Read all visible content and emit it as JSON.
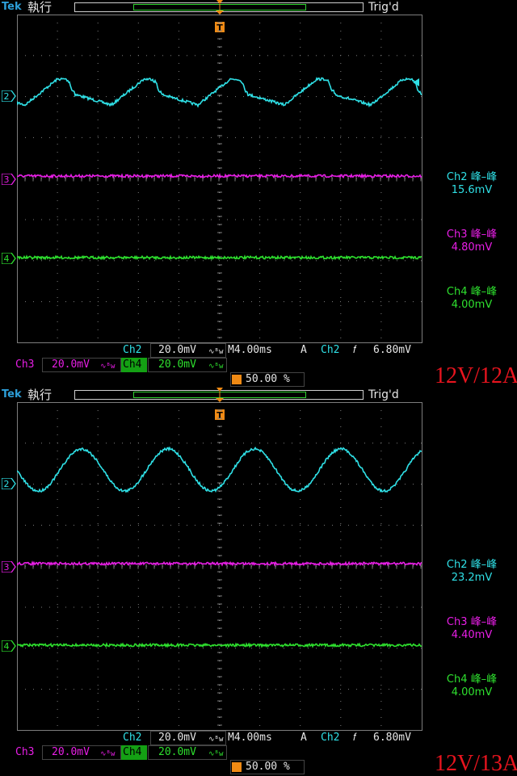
{
  "colors": {
    "ch2": "#2fe0e6",
    "ch3": "#e81ee6",
    "ch4": "#2ee02e",
    "grid": "#7d7d7d",
    "trigger": "#f08a14",
    "text": "#e6e6e6",
    "label": "#e8141e",
    "ch4_box_bg": "#14a014"
  },
  "icons": {
    "trigger_marker": "T",
    "trigger_slope": "rising-edge-icon",
    "bandwidth": "bandwidth-limit-icon",
    "channel_arrow": "channel-ground-arrow-icon"
  },
  "panels": [
    {
      "brand": "Tek",
      "run_state": "執行",
      "trigger_status": "Trig'd",
      "channel_markers": [
        "2",
        "3",
        "4"
      ],
      "waveform_ch2": "sawtooth",
      "measurements": [
        {
          "label": "Ch2 峰–峰",
          "value": "15.6mV",
          "channel": "ch2"
        },
        {
          "label": "Ch3 峰–峰",
          "value": "4.80mV",
          "channel": "ch3"
        },
        {
          "label": "Ch4 峰–峰",
          "value": "4.00mV",
          "channel": "ch4"
        }
      ],
      "footer": {
        "ch2_name": "Ch2",
        "ch2_scale": "20.0mV",
        "timebase": "M4.00ms",
        "acq": "A",
        "trig_src": "Ch2",
        "trig_level": "6.80mV",
        "ch3_name": "Ch3",
        "ch3_scale": "20.0mV",
        "ch4_name": "Ch4",
        "ch4_scale": "20.0mV",
        "trig_pos": "50.00 %"
      },
      "condition_label": "12V/12A"
    },
    {
      "brand": "Tek",
      "run_state": "執行",
      "trigger_status": "Trig'd",
      "channel_markers": [
        "2",
        "3",
        "4"
      ],
      "waveform_ch2": "sine",
      "measurements": [
        {
          "label": "Ch2 峰–峰",
          "value": "23.2mV",
          "channel": "ch2"
        },
        {
          "label": "Ch3 峰–峰",
          "value": "4.40mV",
          "channel": "ch3"
        },
        {
          "label": "Ch4 峰–峰",
          "value": "4.00mV",
          "channel": "ch4"
        }
      ],
      "footer": {
        "ch2_name": "Ch2",
        "ch2_scale": "20.0mV",
        "timebase": "M4.00ms",
        "acq": "A",
        "trig_src": "Ch2",
        "trig_level": "6.80mV",
        "ch3_name": "Ch3",
        "ch3_scale": "20.0mV",
        "ch4_name": "Ch4",
        "ch4_scale": "20.0mV",
        "trig_pos": "50.00 %"
      },
      "condition_label": "12V/13A"
    }
  ]
}
